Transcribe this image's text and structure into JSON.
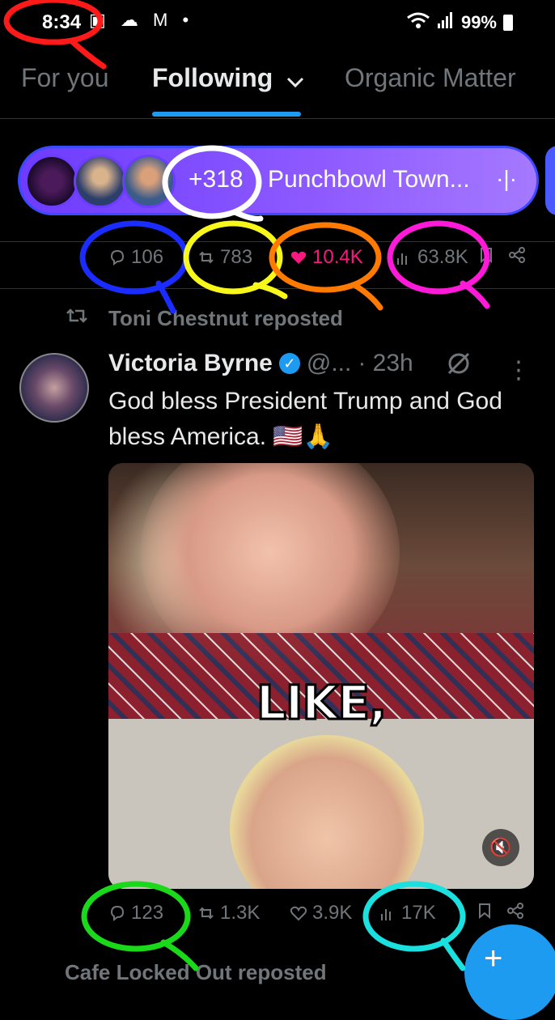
{
  "status_bar": {
    "time": "8:34",
    "left_icons": "▣ ☁ M •",
    "battery": "99%"
  },
  "tabs": [
    {
      "label": "For you",
      "active": false
    },
    {
      "label": "Following",
      "active": true
    },
    {
      "label": "Organic Matter",
      "active": false
    }
  ],
  "spaces": {
    "count": "+318",
    "title": "Punchbowl Town...",
    "avatar_names": [
      "punchbowl-logo",
      "host-avatar",
      "speaker-avatar"
    ]
  },
  "top_actions": {
    "replies": "106",
    "reposts": "783",
    "likes": "10.4K",
    "views": "63.8K"
  },
  "repost_banner": "Toni Chestnut reposted",
  "tweet": {
    "name": "Victoria Byrne",
    "handle": "@...",
    "time": "· 23h",
    "text": "God bless President Trump and God bless America. 🇺🇸🙏",
    "media_caption": "LIKE,",
    "replies": "123",
    "reposts": "1.3K",
    "likes": "3.9K",
    "views": "17K"
  },
  "next_post_peek": "Cafe Locked Out reposted",
  "colors": {
    "accent": "#1d9bf0",
    "like": "#f91880",
    "spaces_purple": "#7b4dff"
  }
}
